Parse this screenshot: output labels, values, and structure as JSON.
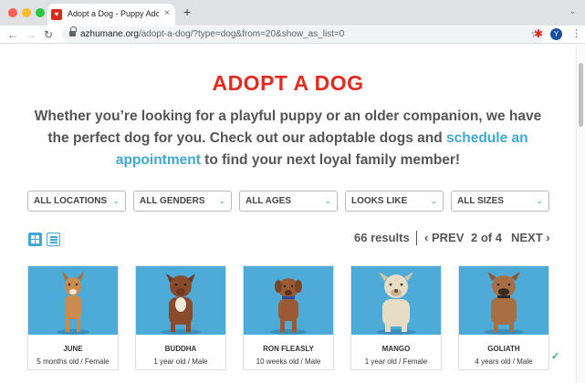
{
  "browser": {
    "tab_title": "Adopt a Dog - Puppy Adoption",
    "tab_close": "×",
    "new_tab": "+",
    "url_host": "azhumane.org",
    "url_path": "/adopt-a-dog/?type=dog&from=20&show_as_list=0",
    "profile_initial": "Y"
  },
  "page": {
    "title": "ADOPT A DOG",
    "intro_part1": "Whether you’re looking for a playful puppy or an older companion, we have the perfect dog for you. Check out our adoptable dogs and ",
    "intro_link": "schedule an appointment",
    "intro_part2": " to find your next loyal family member!"
  },
  "filters": [
    {
      "label": "ALL LOCATIONS"
    },
    {
      "label": "ALL GENDERS"
    },
    {
      "label": "ALL AGES"
    },
    {
      "label": "LOOKS LIKE"
    },
    {
      "label": "ALL SIZES"
    }
  ],
  "results": {
    "count_text": "66 results",
    "prev_label": "PREV",
    "page_text": "2 of 4",
    "next_label": "NEXT"
  },
  "dogs": [
    {
      "name": "JUNE",
      "info": "5 months old / Female",
      "coat": "#c98c4e"
    },
    {
      "name": "BUDDHA",
      "info": "1 year old / Male",
      "coat": "#8a4a2c"
    },
    {
      "name": "RON FLEASLY",
      "info": "10 weeks old / Male",
      "coat": "#9a5a34"
    },
    {
      "name": "MANGO",
      "info": "1 year old / Female",
      "coat": "#e8dcc4"
    },
    {
      "name": "GOLIATH",
      "info": "4 years old / Male",
      "coat": "#a86f45"
    }
  ],
  "colors": {
    "brand_red": "#e32b1f",
    "link_blue": "#3fa8d6",
    "photo_bg": "#4eaad7"
  }
}
